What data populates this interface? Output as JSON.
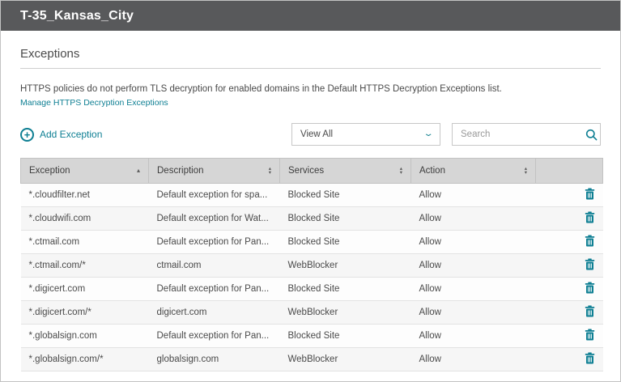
{
  "header": {
    "title": "T-35_Kansas_City"
  },
  "section": {
    "title": "Exceptions"
  },
  "intro": {
    "description": "HTTPS policies do not perform TLS decryption for enabled domains in the Default HTTPS Decryption Exceptions list.",
    "manage_link": "Manage HTTPS Decryption Exceptions"
  },
  "toolbar": {
    "add_label": "Add Exception",
    "filter_value": "View All",
    "search_placeholder": "Search"
  },
  "table": {
    "columns": [
      {
        "label": "Exception",
        "sort": "asc"
      },
      {
        "label": "Description",
        "sort": "both"
      },
      {
        "label": "Services",
        "sort": "both"
      },
      {
        "label": "Action",
        "sort": "both"
      }
    ],
    "rows": [
      {
        "exception": "*.cloudfilter.net",
        "description": "Default exception for spa...",
        "services": "Blocked Site",
        "action": "Allow"
      },
      {
        "exception": "*.cloudwifi.com",
        "description": "Default exception for Wat...",
        "services": "Blocked Site",
        "action": "Allow"
      },
      {
        "exception": "*.ctmail.com",
        "description": "Default exception for Pan...",
        "services": "Blocked Site",
        "action": "Allow"
      },
      {
        "exception": "*.ctmail.com/*",
        "description": "ctmail.com",
        "services": "WebBlocker",
        "action": "Allow"
      },
      {
        "exception": "*.digicert.com",
        "description": "Default exception for Pan...",
        "services": "Blocked Site",
        "action": "Allow"
      },
      {
        "exception": "*.digicert.com/*",
        "description": "digicert.com",
        "services": "WebBlocker",
        "action": "Allow"
      },
      {
        "exception": "*.globalsign.com",
        "description": "Default exception for Pan...",
        "services": "Blocked Site",
        "action": "Allow"
      },
      {
        "exception": "*.globalsign.com/*",
        "description": "globalsign.com",
        "services": "WebBlocker",
        "action": "Allow"
      }
    ]
  },
  "colors": {
    "accent": "#0e7f93",
    "topbar_bg": "#58595b",
    "table_header_bg": "#d6d6d6"
  }
}
